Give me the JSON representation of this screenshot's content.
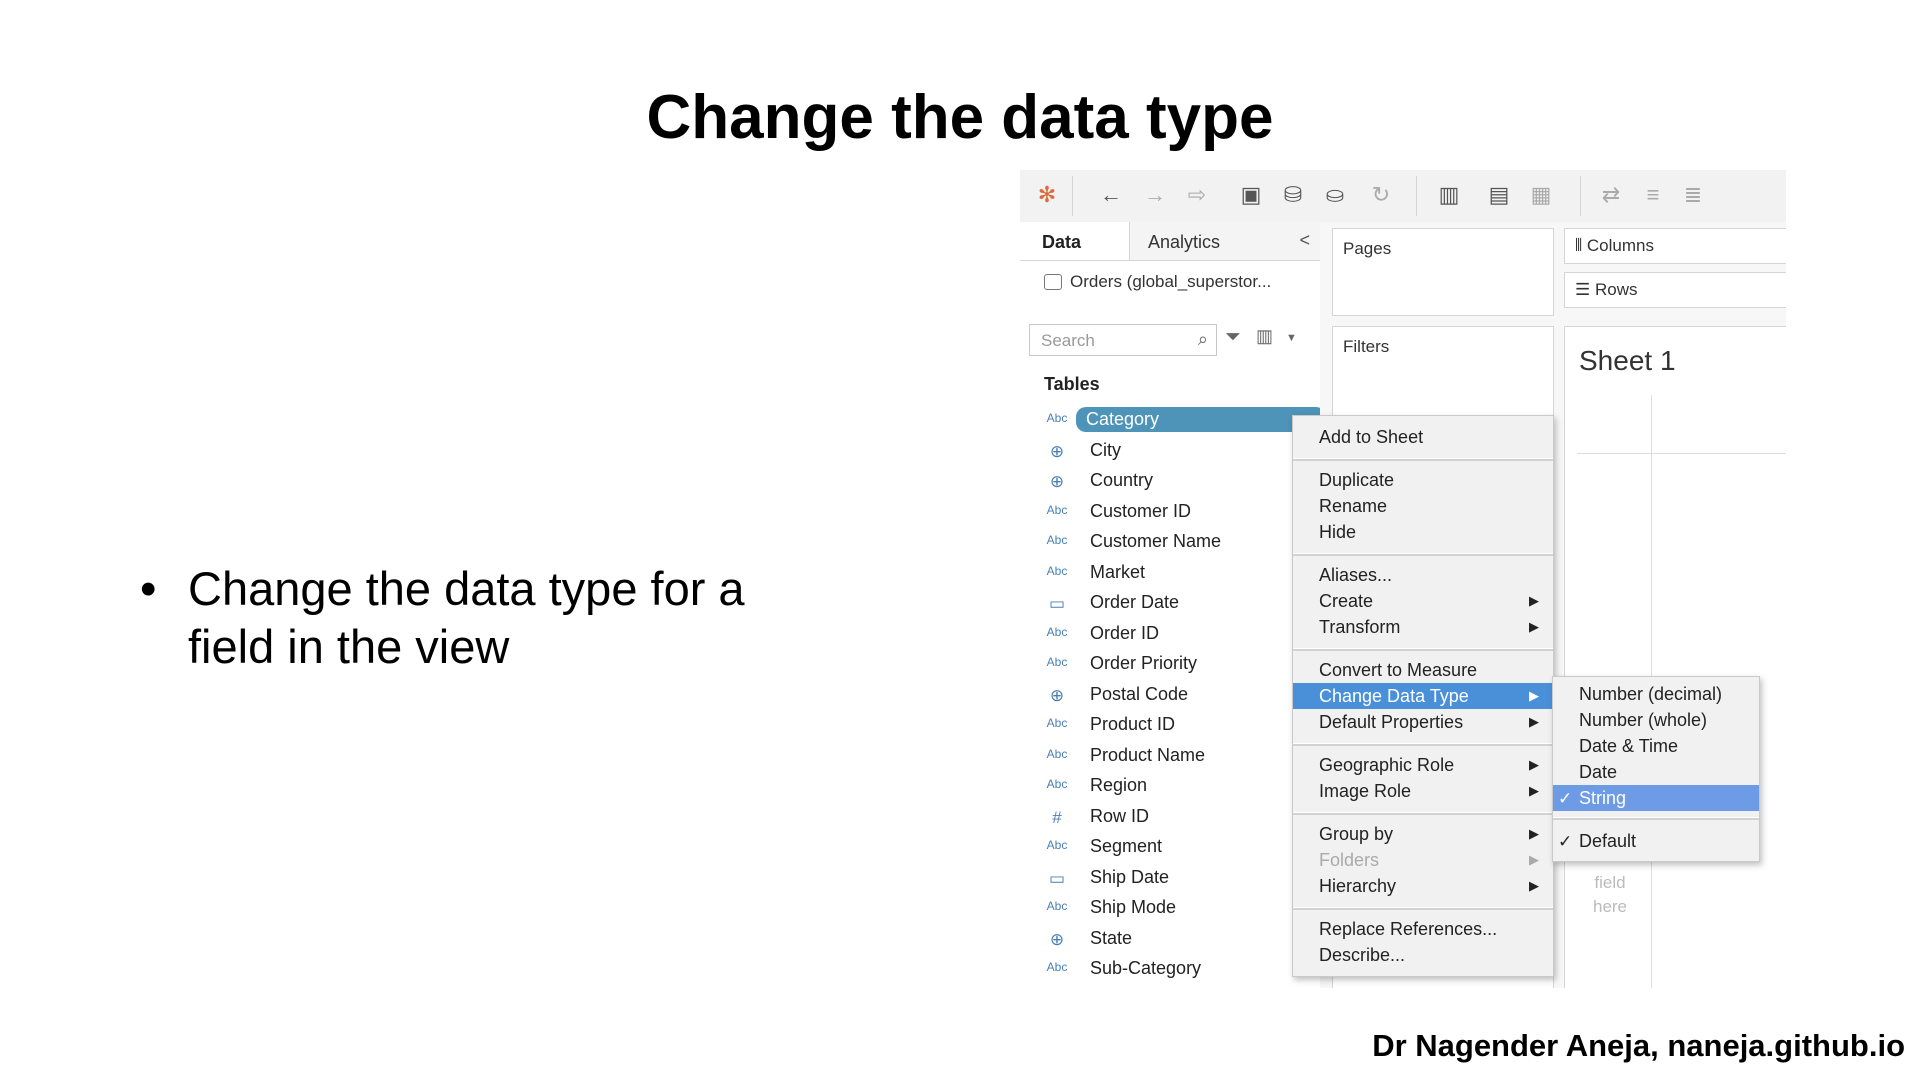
{
  "slide": {
    "title": "Change the data type",
    "bullet_symbol": "•",
    "bullet": "Change the data type for a field in the view",
    "footer": "Dr Nagender Aneja, naneja.github.io"
  },
  "tableau": {
    "pane_tabs": {
      "data": "Data",
      "analytics": "Analytics",
      "collapse_glyph": "<"
    },
    "source": "Orders (global_superstor...",
    "search_placeholder": "Search",
    "tables_header": "Tables",
    "fields": [
      {
        "name": "Category",
        "type_icon": "Abc",
        "selected": true
      },
      {
        "name": "City",
        "type_icon": "⊕"
      },
      {
        "name": "Country",
        "type_icon": "⊕"
      },
      {
        "name": "Customer ID",
        "type_icon": "Abc"
      },
      {
        "name": "Customer Name",
        "type_icon": "Abc"
      },
      {
        "name": "Market",
        "type_icon": "Abc"
      },
      {
        "name": "Order Date",
        "type_icon": "▭"
      },
      {
        "name": "Order ID",
        "type_icon": "Abc"
      },
      {
        "name": "Order Priority",
        "type_icon": "Abc"
      },
      {
        "name": "Postal Code",
        "type_icon": "⊕"
      },
      {
        "name": "Product ID",
        "type_icon": "Abc"
      },
      {
        "name": "Product Name",
        "type_icon": "Abc"
      },
      {
        "name": "Region",
        "type_icon": "Abc"
      },
      {
        "name": "Row ID",
        "type_icon": "#"
      },
      {
        "name": "Segment",
        "type_icon": "Abc"
      },
      {
        "name": "Ship Date",
        "type_icon": "▭"
      },
      {
        "name": "Ship Mode",
        "type_icon": "Abc"
      },
      {
        "name": "State",
        "type_icon": "⊕"
      },
      {
        "name": "Sub-Category",
        "type_icon": "Abc"
      }
    ],
    "shelves": {
      "pages": "Pages",
      "filters": "Filters",
      "columns": "Columns",
      "rows": "Rows",
      "sheet_title": "Sheet 1",
      "drop_hint": "field here"
    },
    "context_menu": [
      {
        "label": "Add to Sheet"
      },
      {
        "label": "Duplicate"
      },
      {
        "label": "Rename"
      },
      {
        "label": "Hide"
      },
      {
        "label": "Aliases..."
      },
      {
        "label": "Create",
        "submenu": true
      },
      {
        "label": "Transform",
        "submenu": true
      },
      {
        "label": "Convert to Measure"
      },
      {
        "label": "Change Data Type",
        "submenu": true,
        "highlighted": true
      },
      {
        "label": "Default Properties",
        "submenu": true
      },
      {
        "label": "Geographic Role",
        "submenu": true
      },
      {
        "label": "Image Role",
        "submenu": true
      },
      {
        "label": "Group by",
        "submenu": true
      },
      {
        "label": "Folders",
        "submenu": true,
        "disabled": true
      },
      {
        "label": "Hierarchy",
        "submenu": true
      },
      {
        "label": "Replace References..."
      },
      {
        "label": "Describe..."
      }
    ],
    "submenu_arrow": "▶",
    "data_type_submenu": [
      {
        "label": "Number (decimal)"
      },
      {
        "label": "Number (whole)"
      },
      {
        "label": "Date & Time"
      },
      {
        "label": "Date"
      },
      {
        "label": "String",
        "checked": true,
        "highlighted": true
      },
      {
        "label": "Default",
        "checked": true
      }
    ],
    "check_glyph": "✓",
    "colors": {
      "selected_field": "#4e94b8",
      "menu_highlight": "#4a90d9",
      "submenu_highlight": "#6d9be6"
    }
  }
}
